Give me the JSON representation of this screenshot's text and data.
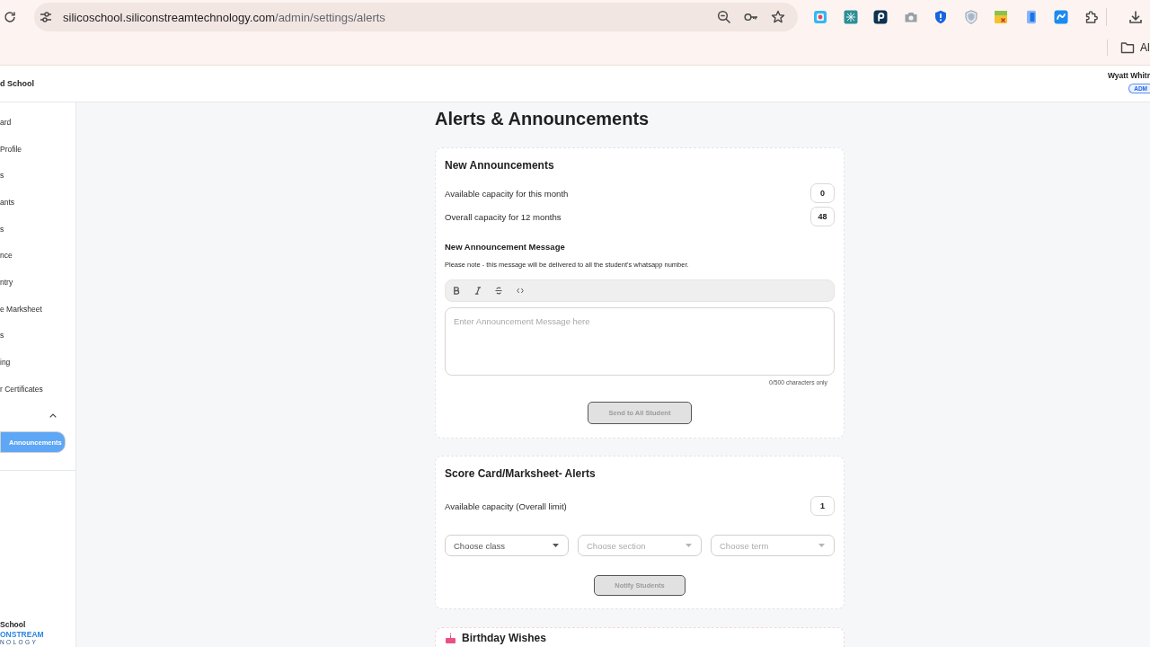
{
  "browser": {
    "address": {
      "host": "silicoschool.siliconstreamtechnology.com",
      "path": "/admin/settings/alerts"
    },
    "bookmark_folder": {
      "label": "Al"
    }
  },
  "header": {
    "school": "d School",
    "user_name": "Wyatt Whitr",
    "role_badge": "ADM"
  },
  "sidebar": {
    "items": [
      {
        "kind": "link",
        "label": "ard",
        "selected": false
      },
      {
        "kind": "link",
        "label": "Profile",
        "selected": false
      },
      {
        "kind": "link",
        "label": "s",
        "selected": false
      },
      {
        "kind": "link",
        "label": "ants",
        "selected": false
      },
      {
        "kind": "link",
        "label": "s",
        "selected": false
      },
      {
        "kind": "link",
        "label": "nce",
        "selected": false
      },
      {
        "kind": "link",
        "label": "ntry",
        "selected": false
      },
      {
        "kind": "link",
        "label": "e Marksheet",
        "selected": false
      },
      {
        "kind": "link",
        "label": "s",
        "selected": false
      },
      {
        "kind": "link",
        "label": "ing",
        "selected": false
      },
      {
        "kind": "link",
        "label": "r Certificates",
        "selected": false
      },
      {
        "kind": "group",
        "expanded": true,
        "children": [
          {
            "label": "Announcements",
            "selected": true
          }
        ]
      }
    ],
    "footer": {
      "school": "School",
      "logo": "ONSTREAM",
      "tagline": "NOLOGY"
    }
  },
  "page_title": "Alerts & Announcements",
  "announcements": {
    "title": "New Announcements",
    "capacities": [
      {
        "label": "Available capacity for this month",
        "value": "0"
      },
      {
        "label": "Overall capacity for 12 months",
        "value": "48"
      }
    ],
    "message_label": "New Announcement Message",
    "note": "Please note - this message will be delivered to all the student's whatsapp number.",
    "toolbar": [
      {
        "kind": "bold"
      },
      {
        "kind": "italic"
      },
      {
        "kind": "strikethrough"
      },
      {
        "kind": "code"
      }
    ],
    "message": {
      "placeholder": "Enter Announcement Message here"
    },
    "counter": "0/500 characters only",
    "send_button": {
      "label": "Send to All Student",
      "disabled": true
    }
  },
  "score_card": {
    "title": "Score Card/Marksheet- Alerts",
    "capacities": [
      {
        "label": "Available capacity (Overall limit)",
        "value": "1"
      }
    ],
    "selects": [
      {
        "placeholder": "Choose class",
        "disabled": false
      },
      {
        "placeholder": "Choose section",
        "disabled": true
      },
      {
        "placeholder": "Choose term",
        "disabled": true
      }
    ],
    "notify_button": {
      "label": "Notify Students",
      "disabled": true
    }
  },
  "birthday": {
    "title": "Birthday Wishes"
  }
}
